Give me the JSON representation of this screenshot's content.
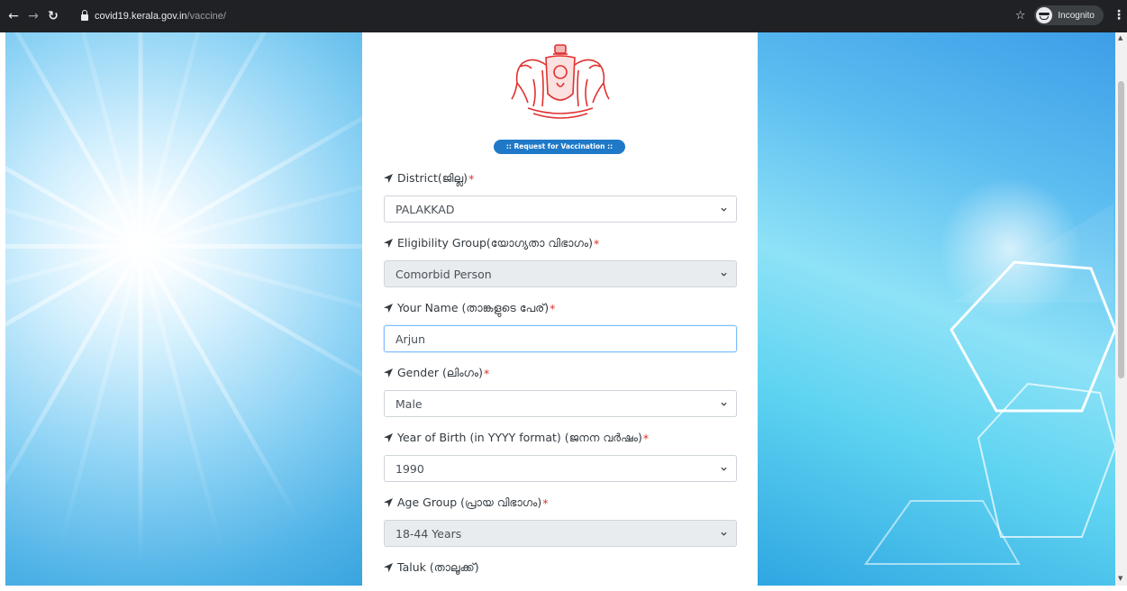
{
  "browser": {
    "url_host": "covid19.kerala.gov.in",
    "url_path": "/vaccine/",
    "incognito_label": "Incognito"
  },
  "page": {
    "banner": ":: Request for Vaccination ::"
  },
  "form": {
    "fields": [
      {
        "label": "District(ജില്ല)",
        "required": "*",
        "type": "select",
        "value": "PALAKKAD"
      },
      {
        "label": "Eligibility Group(യോഗ്യതാ വിഭാഗം)",
        "required": "*",
        "type": "select",
        "value": "Comorbid Person",
        "disabled": true
      },
      {
        "label": "Your Name (താങ്കളുടെ പേര്)",
        "required": "*",
        "type": "text",
        "value": "Arjun"
      },
      {
        "label": "Gender (ലിംഗം)",
        "required": "*",
        "type": "select",
        "value": "Male"
      },
      {
        "label": "Year of Birth (in YYYY format) (ജനന വർഷം)",
        "required": "*",
        "type": "select",
        "value": "1990"
      },
      {
        "label": "Age Group (പ്രായ വിഭാഗം)",
        "required": "*",
        "type": "select",
        "value": "18-44 Years",
        "disabled": true
      },
      {
        "label": "Taluk (താലൂക്ക്)",
        "required": ""
      }
    ]
  },
  "icons": {
    "back": "arrow-left-icon",
    "forward": "arrow-right-icon",
    "reload": "reload-icon",
    "lock": "lock-icon",
    "bookmark": "star-icon",
    "incognito": "incognito-icon",
    "menu": "kebab-menu-icon",
    "label_marker": "location-arrow-icon",
    "select_caret": "chevron-down-icon"
  },
  "colors": {
    "banner_bg": "#1f79c8",
    "required_star": "#d9342b",
    "emblem": "#e0302f",
    "focus_border": "#80bdff"
  }
}
